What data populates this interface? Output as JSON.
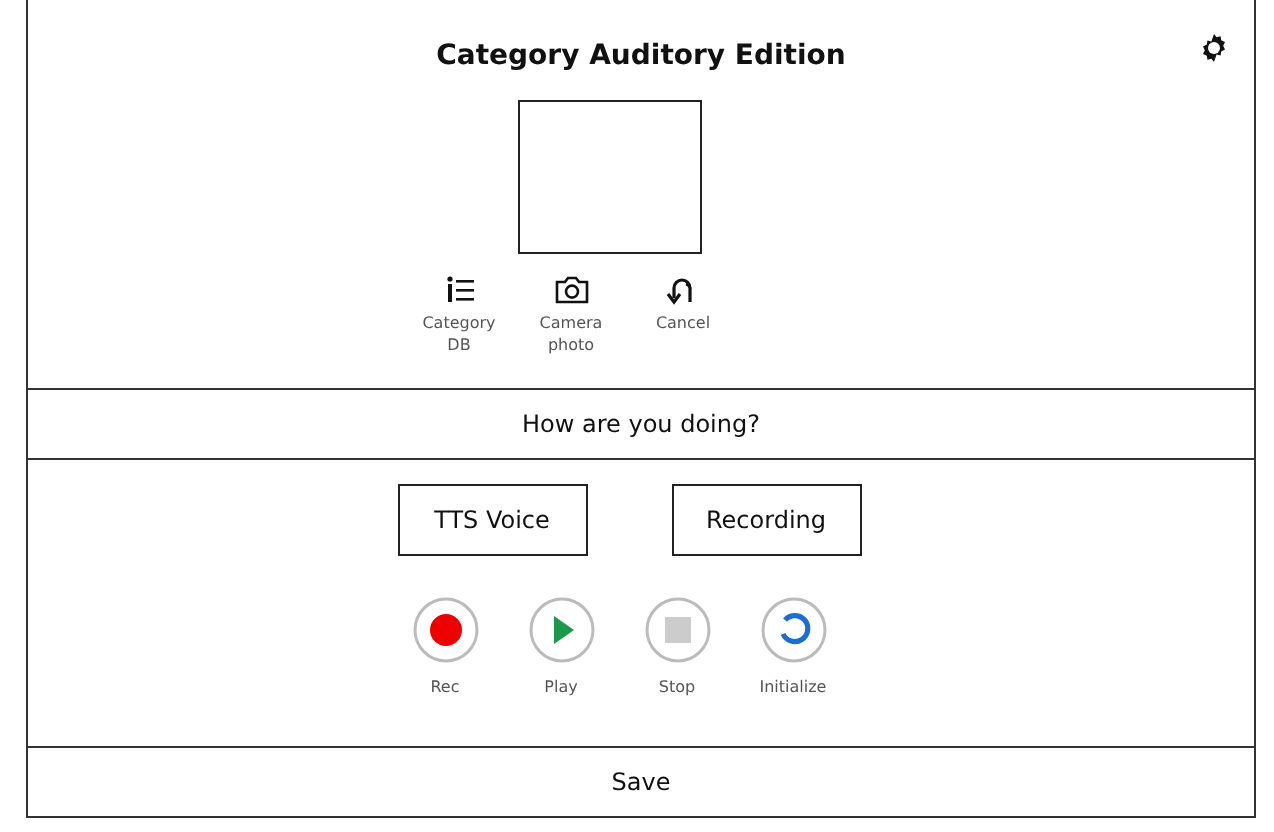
{
  "title": "Category Auditory Edition",
  "actions": [
    {
      "kind": "list",
      "label": "Category\nDB"
    },
    {
      "kind": "camera",
      "label": "Camera\nphoto"
    },
    {
      "kind": "undo",
      "label": "Cancel"
    }
  ],
  "prompt": "How are you doing?",
  "buttons": [
    "TTS Voice",
    "Recording"
  ],
  "controls": [
    {
      "kind": "rec",
      "label": "Rec",
      "disabled": false
    },
    {
      "kind": "play",
      "label": "Play",
      "disabled": false
    },
    {
      "kind": "stop",
      "label": "Stop",
      "disabled": true
    },
    {
      "kind": "initialize",
      "label": "Initialize",
      "disabled": false
    }
  ],
  "save": "Save"
}
